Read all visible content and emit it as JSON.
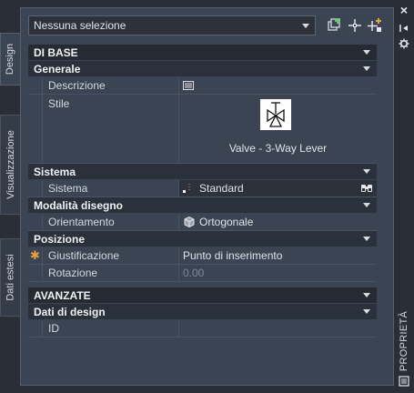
{
  "left_tabs": [
    {
      "label": "Design",
      "active": true
    },
    {
      "label": "Visualizzazione",
      "active": false
    },
    {
      "label": "Dati estesi",
      "active": false
    }
  ],
  "right_strip": {
    "close": "×",
    "label": "PROPRIETÀ"
  },
  "toolbar": {
    "selection_value": "Nessuna selezione"
  },
  "sections": {
    "base": "DI BASE",
    "generale": "Generale",
    "sistema": "Sistema",
    "modalita": "Modalità disegno",
    "posizione": "Posizione",
    "avanzate": "AVANZATE",
    "dati_design": "Dati di design"
  },
  "props": {
    "descrizione": {
      "name": "Descrizione",
      "value": ""
    },
    "stile": {
      "name": "Stile",
      "value": "Valve - 3-Way Lever"
    },
    "sistema": {
      "name": "Sistema",
      "value": "Standard"
    },
    "orientamento": {
      "name": "Orientamento",
      "value": "Ortogonale"
    },
    "giustificazione": {
      "name": "Giustificazione",
      "value": "Punto di inserimento"
    },
    "rotazione": {
      "name": "Rotazione",
      "value": "0.00"
    },
    "id": {
      "name": "ID",
      "value": ""
    }
  },
  "colors": {
    "panel_bg": "#3b4453",
    "section_bg": "#2b313b",
    "accent_orange": "#e8a040",
    "plus_green": "#5fd35f"
  }
}
